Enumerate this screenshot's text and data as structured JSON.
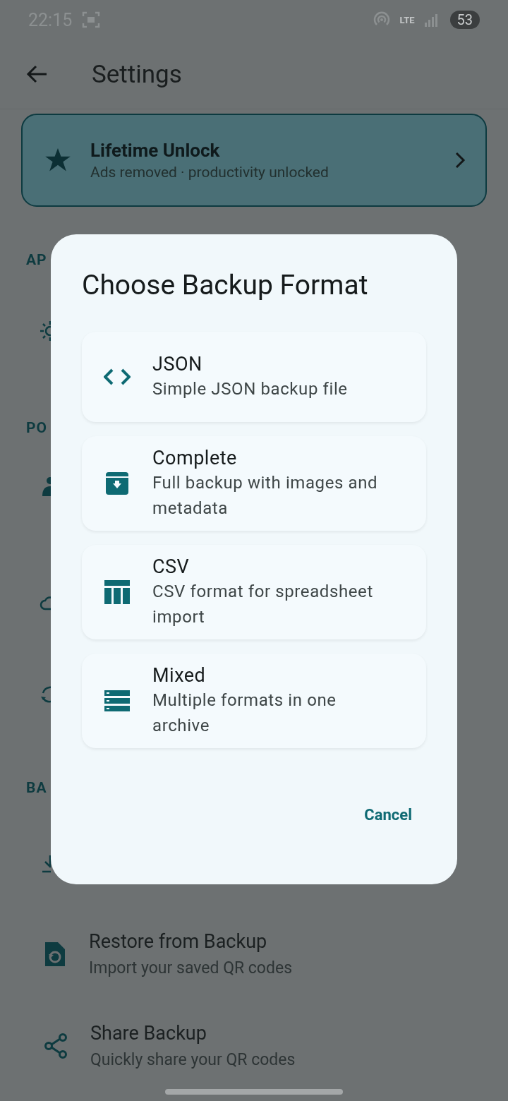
{
  "status_bar": {
    "time": "22:15",
    "network": "LTE",
    "battery": "53"
  },
  "app_bar": {
    "title": "Settings"
  },
  "unlock_card": {
    "title": "Lifetime Unlock",
    "subtitle": "Ads removed · productivity unlocked"
  },
  "section_headers": [
    "AP",
    "PO",
    "BA"
  ],
  "backup_items": [
    {
      "kind": "restore",
      "title": "Restore from Backup",
      "subtitle": "Import your saved QR codes"
    },
    {
      "kind": "share",
      "title": "Share Backup",
      "subtitle": "Quickly share your QR codes"
    }
  ],
  "dialog": {
    "title": "Choose Backup Format",
    "options": [
      {
        "kind": "json",
        "title": "JSON",
        "subtitle": "Simple JSON backup file"
      },
      {
        "kind": "complete",
        "title": "Complete",
        "subtitle": "Full backup with images and metadata"
      },
      {
        "kind": "csv",
        "title": "CSV",
        "subtitle": "CSV format for spreadsheet import"
      },
      {
        "kind": "mixed",
        "title": "Mixed",
        "subtitle": "Multiple formats in one archive"
      }
    ],
    "cancel": "Cancel"
  }
}
